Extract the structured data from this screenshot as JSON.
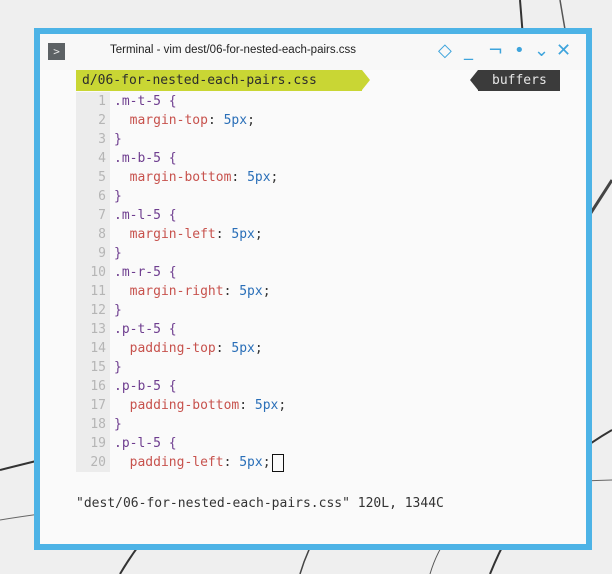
{
  "window": {
    "title": "Terminal - vim dest/06-for-nested-each-pairs.css",
    "app_icon_glyph": ">",
    "controls": [
      "◇",
      "_",
      "¬",
      "•",
      "⌄",
      "✕"
    ],
    "accent": "#4db3e6"
  },
  "tabline": {
    "active_tab": "d/06-for-nested-each-pairs.css",
    "buffers_label": "buffers"
  },
  "lines": [
    {
      "num": "1",
      "sel": ".m-t-5",
      "open": " {"
    },
    {
      "num": "2",
      "prop": "margin-top",
      "val": "5px"
    },
    {
      "num": "3",
      "close": "}"
    },
    {
      "num": "4",
      "sel": ".m-b-5",
      "open": " {"
    },
    {
      "num": "5",
      "prop": "margin-bottom",
      "val": "5px"
    },
    {
      "num": "6",
      "close": "}"
    },
    {
      "num": "7",
      "sel": ".m-l-5",
      "open": " {"
    },
    {
      "num": "8",
      "prop": "margin-left",
      "val": "5px"
    },
    {
      "num": "9",
      "close": "}"
    },
    {
      "num": "10",
      "sel": ".m-r-5",
      "open": " {"
    },
    {
      "num": "11",
      "prop": "margin-right",
      "val": "5px"
    },
    {
      "num": "12",
      "close": "}"
    },
    {
      "num": "13",
      "sel": ".p-t-5",
      "open": " {"
    },
    {
      "num": "14",
      "prop": "padding-top",
      "val": "5px"
    },
    {
      "num": "15",
      "close": "}"
    },
    {
      "num": "16",
      "sel": ".p-b-5",
      "open": " {"
    },
    {
      "num": "17",
      "prop": "padding-bottom",
      "val": "5px"
    },
    {
      "num": "18",
      "close": "}"
    },
    {
      "num": "19",
      "sel": ".p-l-5",
      "open": " {"
    },
    {
      "num": "20",
      "prop": "padding-left",
      "val": "5px",
      "cursor": true
    }
  ],
  "command_line": "\"dest/06-for-nested-each-pairs.css\" 120L, 1344C"
}
